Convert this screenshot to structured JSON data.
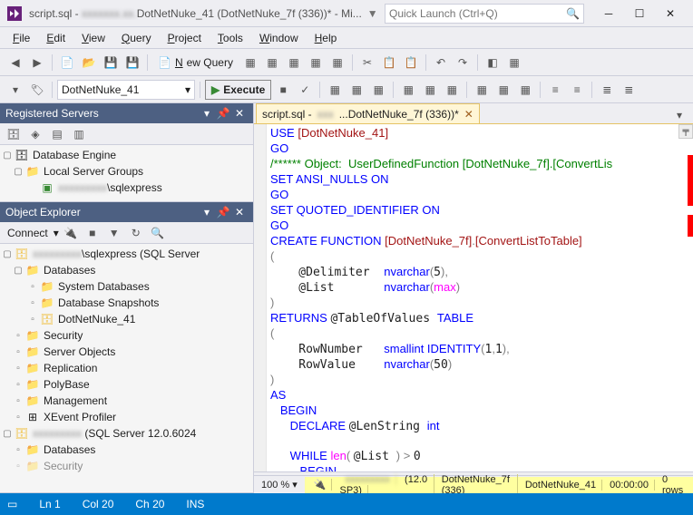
{
  "window": {
    "title_prefix": "script.sql - ",
    "title_blur": "xxxxxxx.xx.",
    "title_suffix": "DotNetNuke_41 (DotNetNuke_7f (336))* - Mi...",
    "quick_launch_placeholder": "Quick Launch (Ctrl+Q)"
  },
  "menu": {
    "file": "File",
    "edit": "Edit",
    "view": "View",
    "query": "Query",
    "project": "Project",
    "tools": "Tools",
    "window": "Window",
    "help": "Help"
  },
  "toolbar": {
    "new_query": "New Query",
    "db_combo": "DotNetNuke_41",
    "execute": "Execute"
  },
  "registered_servers": {
    "title": "Registered Servers",
    "root": "Database Engine",
    "group": "Local Server Groups",
    "server_blur": "xxxxxxxxx",
    "server_suffix": "\\sqlexpress"
  },
  "object_explorer": {
    "title": "Object Explorer",
    "connect": "Connect",
    "server_blur": "xxxxxxxxx",
    "server_suffix": "\\sqlexpress (SQL Server",
    "nodes": {
      "databases": "Databases",
      "sysdb": "System Databases",
      "snapshots": "Database Snapshots",
      "userdb": "DotNetNuke_41",
      "security": "Security",
      "server_objects": "Server Objects",
      "replication": "Replication",
      "polybase": "PolyBase",
      "management": "Management",
      "xevent": "XEvent Profiler"
    },
    "server2_blur": "xxxxxxxxx",
    "server2_suffix": " (SQL Server 12.0.6024",
    "server2_databases": "Databases",
    "server2_security": "Security"
  },
  "tab": {
    "prefix": "script.sql - ",
    "blur": "xxx",
    "suffix": "...DotNetNuke_7f (336))*"
  },
  "code_lines": [
    {
      "t": "kw",
      "s": "USE "
    },
    {
      "t": "str",
      "s": "[DotNetNuke_41]"
    },
    {
      "nl": 1
    },
    {
      "t": "kw",
      "s": "GO"
    },
    {
      "nl": 1
    },
    {
      "t": "cm",
      "s": "/****** Object:  UserDefinedFunction [DotNetNuke_7f].[ConvertLis"
    },
    {
      "nl": 1
    },
    {
      "t": "kw",
      "s": "SET ANSI_NULLS ON"
    },
    {
      "nl": 1
    },
    {
      "t": "kw",
      "s": "GO"
    },
    {
      "nl": 1
    },
    {
      "t": "kw",
      "s": "SET QUOTED_IDENTIFIER ON"
    },
    {
      "nl": 1
    },
    {
      "t": "kw",
      "s": "GO"
    },
    {
      "nl": 1
    },
    {
      "t": "kw",
      "s": "CREATE FUNCTION "
    },
    {
      "t": "str",
      "s": "[DotNetNuke_7f]"
    },
    {
      "t": "gray",
      "s": "."
    },
    {
      "t": "str",
      "s": "[ConvertListToTable]"
    },
    {
      "nl": 1
    },
    {
      "t": "gray",
      "s": "("
    },
    {
      "nl": 1
    },
    {
      "t": "",
      "s": "    @Delimiter  "
    },
    {
      "t": "kw",
      "s": "nvarchar"
    },
    {
      "t": "gray",
      "s": "("
    },
    {
      "t": "",
      "s": "5"
    },
    {
      "t": "gray",
      "s": "),"
    },
    {
      "nl": 1
    },
    {
      "t": "",
      "s": "    @List       "
    },
    {
      "t": "kw",
      "s": "nvarchar"
    },
    {
      "t": "gray",
      "s": "("
    },
    {
      "t": "fn",
      "s": "max"
    },
    {
      "t": "gray",
      "s": ")"
    },
    {
      "nl": 1
    },
    {
      "t": "gray",
      "s": ")"
    },
    {
      "nl": 1
    },
    {
      "t": "kw",
      "s": "RETURNS "
    },
    {
      "t": "",
      "s": "@TableOfValues "
    },
    {
      "t": "kw",
      "s": "TABLE"
    },
    {
      "nl": 1
    },
    {
      "t": "gray",
      "s": "("
    },
    {
      "nl": 1
    },
    {
      "t": "",
      "s": "    RowNumber   "
    },
    {
      "t": "kw",
      "s": "smallint IDENTITY"
    },
    {
      "t": "gray",
      "s": "("
    },
    {
      "t": "",
      "s": "1"
    },
    {
      "t": "gray",
      "s": ","
    },
    {
      "t": "",
      "s": "1"
    },
    {
      "t": "gray",
      "s": "),"
    },
    {
      "nl": 1
    },
    {
      "t": "",
      "s": "    RowValue    "
    },
    {
      "t": "kw",
      "s": "nvarchar"
    },
    {
      "t": "gray",
      "s": "("
    },
    {
      "t": "",
      "s": "50"
    },
    {
      "t": "gray",
      "s": ")"
    },
    {
      "nl": 1
    },
    {
      "t": "gray",
      "s": ")"
    },
    {
      "nl": 1
    },
    {
      "t": "kw",
      "s": "AS"
    },
    {
      "nl": 1
    },
    {
      "t": "kw",
      "s": "   BEGIN"
    },
    {
      "nl": 1
    },
    {
      "t": "kw",
      "s": "      DECLARE "
    },
    {
      "t": "",
      "s": "@LenString "
    },
    {
      "t": "kw",
      "s": "int"
    },
    {
      "nl": 1
    },
    {
      "t": "",
      "s": ""
    },
    {
      "nl": 1
    },
    {
      "t": "kw",
      "s": "      WHILE "
    },
    {
      "t": "fn",
      "s": "len"
    },
    {
      "t": "gray",
      "s": "( "
    },
    {
      "t": "",
      "s": "@List "
    },
    {
      "t": "gray",
      "s": ") > "
    },
    {
      "t": "",
      "s": "0"
    },
    {
      "nl": 1
    },
    {
      "t": "kw",
      "s": "         BEGIN"
    },
    {
      "nl": 1
    }
  ],
  "editor_footer": {
    "zoom": "100 %"
  },
  "conn_bar": {
    "server_blur": "xxxxxxxxx",
    "server_suffix": " (12.0 SP3)",
    "db_user": "DotNetNuke_7f (336)",
    "db": "DotNetNuke_41",
    "time": "00:00:00",
    "rows": "0 rows"
  },
  "status": {
    "ln": "Ln 1",
    "col": "Col 20",
    "ch": "Ch 20",
    "ins": "INS"
  }
}
